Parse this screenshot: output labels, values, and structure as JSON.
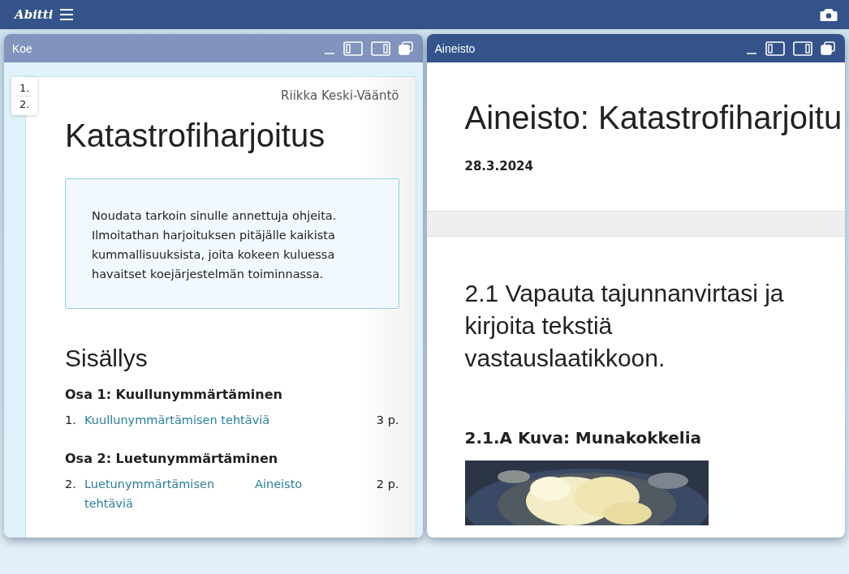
{
  "topbar": {
    "logo": "Abitti"
  },
  "windows": [
    {
      "title": "Koe",
      "active": false,
      "kind": "exam",
      "nav": [
        "1.",
        "2."
      ],
      "author": "Riikka Keski-Vääntö",
      "heading": "Katastrofiharjoitus",
      "instructions": "Noudata tarkoin sinulle annettuja ohjeita. Ilmoitathan harjoituksen pitäjälle kaikista kummallisuuksista, joita kokeen kuluessa havaitset koejärjestelmän toiminnassa.",
      "toc_title": "Sisällys",
      "sections": [
        {
          "title": "Osa 1: Kuullunymmärtäminen",
          "items": [
            {
              "number": "1.",
              "link": "Kuullunymmärtämisen tehtäviä",
              "points": "3 p."
            }
          ]
        },
        {
          "title": "Osa 2: Luetunymmärtäminen",
          "items": [
            {
              "number": "2.",
              "link": "Luetunymmärtämisen tehtäviä",
              "extra_link": "Aineisto",
              "points": "2 p."
            }
          ]
        }
      ]
    },
    {
      "title": "Aineisto",
      "active": true,
      "kind": "material",
      "heading": "Aineisto: Katastrofiharjoitu",
      "date": "28.3.2024",
      "question": "2.1 Vapauta tajunnanvirtasi ja kirjoita tekstiä vastauslaatikkoon.",
      "subheading": "2.1.A Kuva: Munakokkelia"
    }
  ]
}
